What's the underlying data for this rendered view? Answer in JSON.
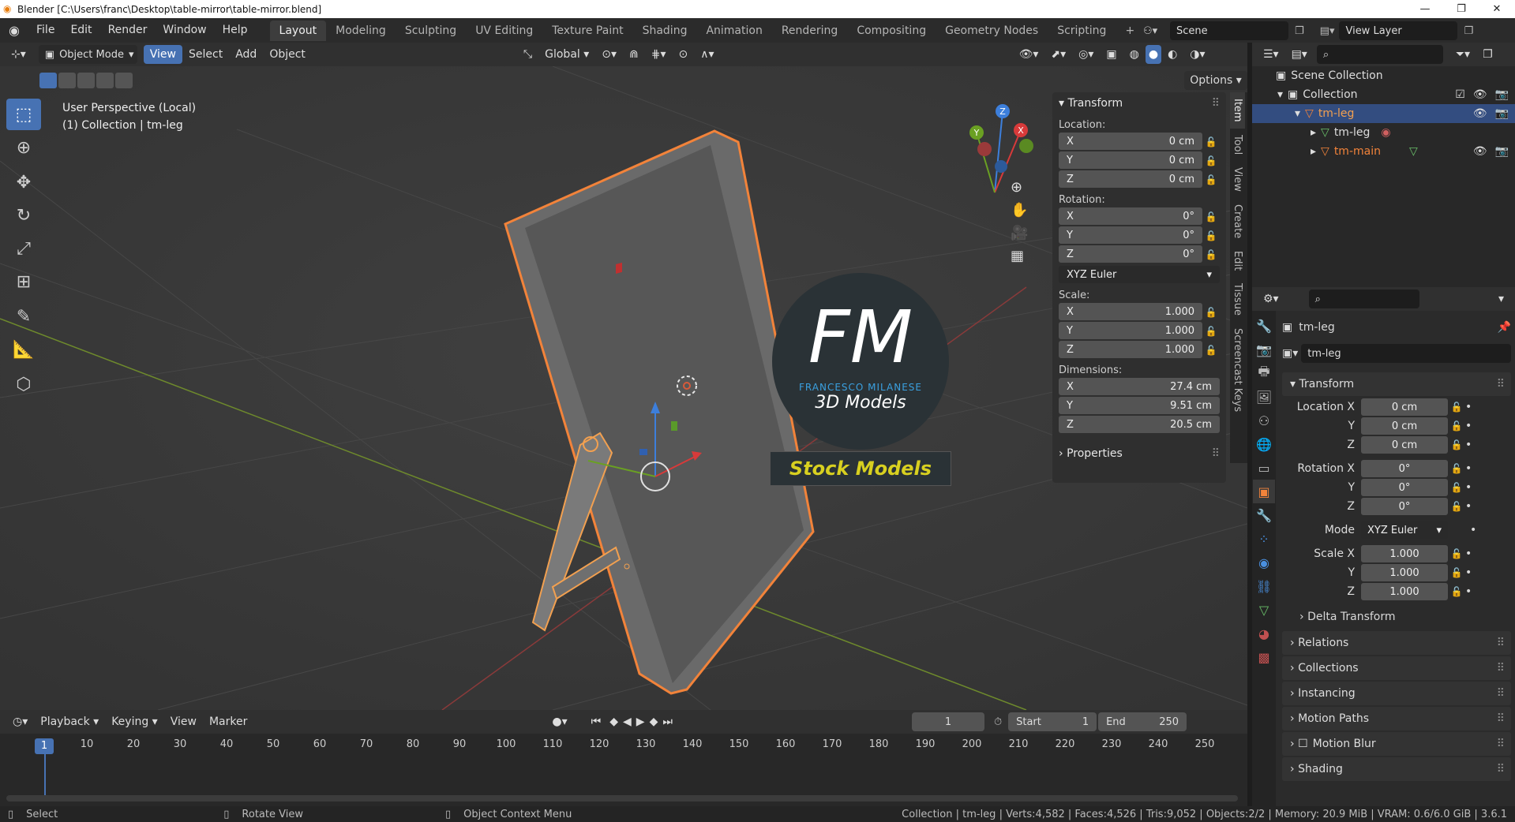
{
  "window": {
    "title": "Blender [C:\\Users\\franc\\Desktop\\table-mirror\\table-mirror.blend]"
  },
  "menus": [
    "File",
    "Edit",
    "Render",
    "Window",
    "Help"
  ],
  "workspaces": [
    "Layout",
    "Modeling",
    "Sculpting",
    "UV Editing",
    "Texture Paint",
    "Shading",
    "Animation",
    "Rendering",
    "Compositing",
    "Geometry Nodes",
    "Scripting"
  ],
  "scene": {
    "name": "Scene",
    "view_layer": "View Layer"
  },
  "header3d": {
    "mode": "Object Mode",
    "items": [
      "View",
      "Select",
      "Add",
      "Object"
    ],
    "orientation": "Global",
    "options": "Options"
  },
  "viewport": {
    "perspective": "User Perspective (Local)",
    "context": "(1) Collection | tm-leg"
  },
  "watermark": {
    "letters": "FM",
    "name": "FRANCESCO MILANESE",
    "sub": "3D Models",
    "badge": "Stock Models"
  },
  "npanel": {
    "title": "Transform",
    "location_label": "Location:",
    "location": [
      {
        "axis": "X",
        "value": "0 cm"
      },
      {
        "axis": "Y",
        "value": "0 cm"
      },
      {
        "axis": "Z",
        "value": "0 cm"
      }
    ],
    "rotation_label": "Rotation:",
    "rotation": [
      {
        "axis": "X",
        "value": "0°"
      },
      {
        "axis": "Y",
        "value": "0°"
      },
      {
        "axis": "Z",
        "value": "0°"
      }
    ],
    "rotation_mode": "XYZ Euler",
    "scale_label": "Scale:",
    "scale": [
      {
        "axis": "X",
        "value": "1.000"
      },
      {
        "axis": "Y",
        "value": "1.000"
      },
      {
        "axis": "Z",
        "value": "1.000"
      }
    ],
    "dimensions_label": "Dimensions:",
    "dimensions": [
      {
        "axis": "X",
        "value": "27.4 cm"
      },
      {
        "axis": "Y",
        "value": "9.51 cm"
      },
      {
        "axis": "Z",
        "value": "20.5 cm"
      }
    ],
    "properties": "Properties",
    "tabs": [
      "Item",
      "Tool",
      "View",
      "Create",
      "Edit",
      "Tissue",
      "Screencast Keys"
    ]
  },
  "outliner": {
    "scene_collection": "Scene Collection",
    "collection": "Collection",
    "items": [
      "tm-leg",
      "tm-leg",
      "tm-main"
    ]
  },
  "properties": {
    "object_name": "tm-leg",
    "data_name": "tm-leg",
    "transform": "Transform",
    "location_x_label": "Location X",
    "rotation_x_label": "Rotation X",
    "scale_x_label": "Scale X",
    "y_label": "Y",
    "z_label": "Z",
    "mode_label": "Mode",
    "mode_value": "XYZ Euler",
    "location": [
      "0 cm",
      "0 cm",
      "0 cm"
    ],
    "rotation": [
      "0°",
      "0°",
      "0°"
    ],
    "scale": [
      "1.000",
      "1.000",
      "1.000"
    ],
    "delta": "Delta Transform",
    "panels": [
      "Relations",
      "Collections",
      "Instancing",
      "Motion Paths",
      "Motion Blur",
      "Shading"
    ]
  },
  "timeline": {
    "menus": [
      "Playback",
      "Keying",
      "View",
      "Marker"
    ],
    "current_frame": "1",
    "start_label": "Start",
    "start": "1",
    "end_label": "End",
    "end": "250",
    "ticks": [
      "10",
      "20",
      "30",
      "40",
      "50",
      "60",
      "70",
      "80",
      "90",
      "100",
      "110",
      "120",
      "130",
      "140",
      "150",
      "160",
      "170",
      "180",
      "190",
      "200",
      "210",
      "220",
      "230",
      "240",
      "250"
    ]
  },
  "status": {
    "select": "Select",
    "rotate": "Rotate View",
    "context_menu": "Object Context Menu",
    "stats": "Collection | tm-leg | Verts:4,582 | Faces:4,526 | Tris:9,052 | Objects:2/2 | Memory: 20.9 MiB | VRAM: 0.6/6.0 GiB | 3.6.1"
  },
  "colors": {
    "accent": "#4772b3",
    "selection_orange": "#f2833a",
    "badge_text": "#d8d020"
  }
}
